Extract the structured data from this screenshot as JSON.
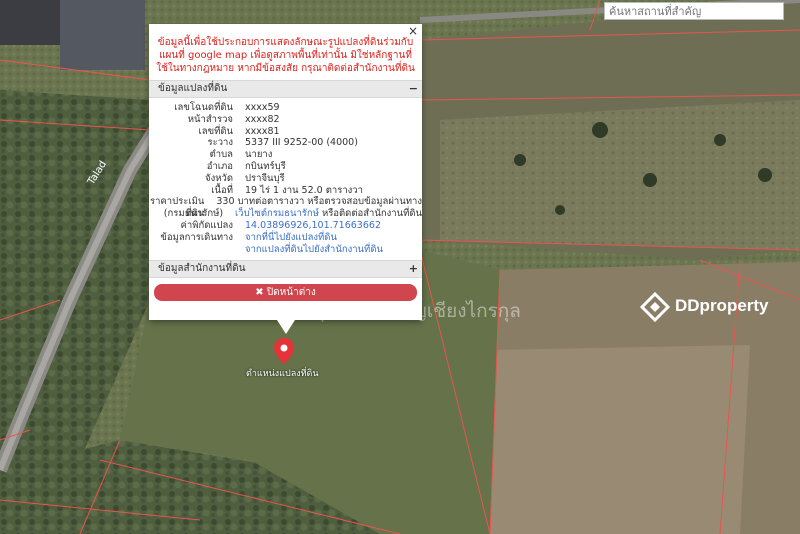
{
  "search": {
    "placeholder": "ค้นหาสถานที่สำคัญ"
  },
  "popup": {
    "close_symbol": "×",
    "disclaimer": "ข้อมูลนี้เพื่อใช้ประกอบการแสดงลักษณะรูปแปลงที่ดินร่วมกับแผนที่ google map เพื่อดูสภาพพื้นที่เท่านั้น มิใช่หลักฐานที่ใช้ในทางกฎหมาย หากมีข้อสงสัย กรุณาติดต่อสำนักงานที่ดิน",
    "section_land": {
      "title": "ข้อมูลแปลงที่ดิน",
      "toggle": "−"
    },
    "details": [
      {
        "label": "เลขโฉนดที่ดิน",
        "value": "xxxx59"
      },
      {
        "label": "หน้าสำรวจ",
        "value": "xxxx82"
      },
      {
        "label": "เลขที่ดิน",
        "value": "xxxx81"
      },
      {
        "label": "ระวาง",
        "value": "5337 III 9252-00 (4000)"
      },
      {
        "label": "ตำบล",
        "value": "นายาง"
      },
      {
        "label": "อำเภอ",
        "value": "กบินทร์บุรี"
      },
      {
        "label": "จังหวัด",
        "value": "ปราจีนบุรี"
      },
      {
        "label": "เนื้อที่",
        "value": "19 ไร่ 1 งาน 52.0 ตารางวา"
      },
      {
        "label": "ราคาประเมินที่ดิน",
        "value": "330 บาทต่อตารางวา หรือตรวจสอบข้อมูลผ่านทาง"
      },
      {
        "label": "(กรมธนารักษ์)",
        "value": "เว็บไซต์กรมธนารักษ์",
        "value2": " หรือติดต่อสำนักงานที่ดิน"
      },
      {
        "label": "ค่าพิกัดแปลง",
        "value": "14.03896926,101.71663662"
      },
      {
        "label": "ข้อมูลการเดินทาง",
        "value": "จากที่นี่ไปยังแปลงที่ดิน"
      },
      {
        "label": "",
        "value": "จากแปลงที่ดินไปยังสำนักงานที่ดิน"
      }
    ],
    "section_office": {
      "title": "ข้อมูลสำนักงานที่ดิน",
      "toggle": "+"
    },
    "close_button": {
      "icon": "✖",
      "label": " ปิดหน้าต่าง"
    }
  },
  "map": {
    "road_label": "Talad",
    "pin_label": "ตำแหน่งแปลงที่ดิน",
    "watermark_text": "คุณวิทย์ เจริญเชียงไกรกุล",
    "logo_text": "DDproperty",
    "colors": {
      "boundary": "#e8554f",
      "pin": "#e5333a",
      "link": "#3a70c9",
      "disclaimer": "#e0201b"
    }
  }
}
